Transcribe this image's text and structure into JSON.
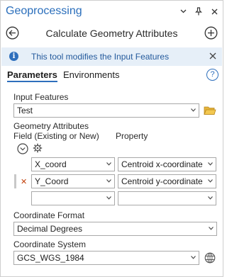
{
  "titlebar": {
    "title": "Geoprocessing",
    "icons": [
      "chevron-down-icon",
      "pin-icon",
      "close-icon"
    ]
  },
  "nav": {
    "tool_title": "Calculate Geometry Attributes",
    "back_icon": "back-arrow-icon",
    "add_icon": "add-icon"
  },
  "banner": {
    "message": "This tool modifies the Input Features",
    "icon": "info-icon",
    "close_icon": "close-icon"
  },
  "tabs": [
    {
      "label": "Parameters",
      "active": true
    },
    {
      "label": "Environments",
      "active": false
    }
  ],
  "help_glyph": "?",
  "info_glyph": "i",
  "input_features": {
    "label": "Input Features",
    "value": "Test"
  },
  "geometry_attributes": {
    "label": "Geometry Attributes",
    "field_header": "Field (Existing or New)",
    "property_header": "Property",
    "rows": [
      {
        "field": "X_coord",
        "property": "Centroid x-coordinate",
        "marked": false
      },
      {
        "field": "Y_Coord",
        "property": "Centroid y-coordinate",
        "marked": true
      },
      {
        "field": "",
        "property": "",
        "marked": false
      }
    ],
    "delete_glyph": "✕"
  },
  "coordinate_format": {
    "label": "Coordinate Format",
    "value": "Decimal Degrees"
  },
  "coordinate_system": {
    "label": "Coordinate System",
    "value": "GCS_WGS_1984"
  },
  "colors": {
    "accent": "#2e6fbc",
    "title": "#2a6ebb",
    "banner_bg": "#e6eff8",
    "banner_text": "#245a9c",
    "delete": "#c2410c",
    "folder": "#d9a521"
  }
}
